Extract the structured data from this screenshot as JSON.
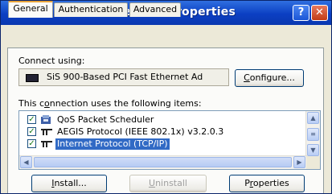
{
  "window": {
    "title": "Local Area Connection Properties",
    "help_label": "?",
    "close_label": "✕"
  },
  "tabs": [
    {
      "label": "General"
    },
    {
      "label": "Authentication"
    },
    {
      "label": "Advanced"
    }
  ],
  "general": {
    "connect_using_label": "Connect using:",
    "adapter_name": "SiS 900-Based PCI Fast Ethernet Ad",
    "configure_button": {
      "before": "",
      "ul": "C",
      "after": "onfigure..."
    },
    "items_label": {
      "before": "This c",
      "ul": "o",
      "after": "nnection uses the following items:"
    },
    "items": [
      {
        "label": "QoS Packet Scheduler",
        "checked": true,
        "icon": "scheduler-icon"
      },
      {
        "label": "AEGIS Protocol (IEEE 802.1x) v3.2.0.3",
        "checked": true,
        "icon": "network-protocol-icon"
      },
      {
        "label": "Internet Protocol (TCP/IP)",
        "checked": true,
        "icon": "network-protocol-icon",
        "selected": true
      }
    ],
    "install_button": {
      "before": "",
      "ul": "I",
      "after": "nstall..."
    },
    "uninstall_button": {
      "before": "",
      "ul": "U",
      "after": "ninstall"
    },
    "properties_button": {
      "before": "P",
      "ul": "r",
      "after": "operties"
    }
  },
  "colors": {
    "titlebar": "#0b3fc3",
    "selection": "#316ac5",
    "tab_highlight": "#e8a33a"
  }
}
